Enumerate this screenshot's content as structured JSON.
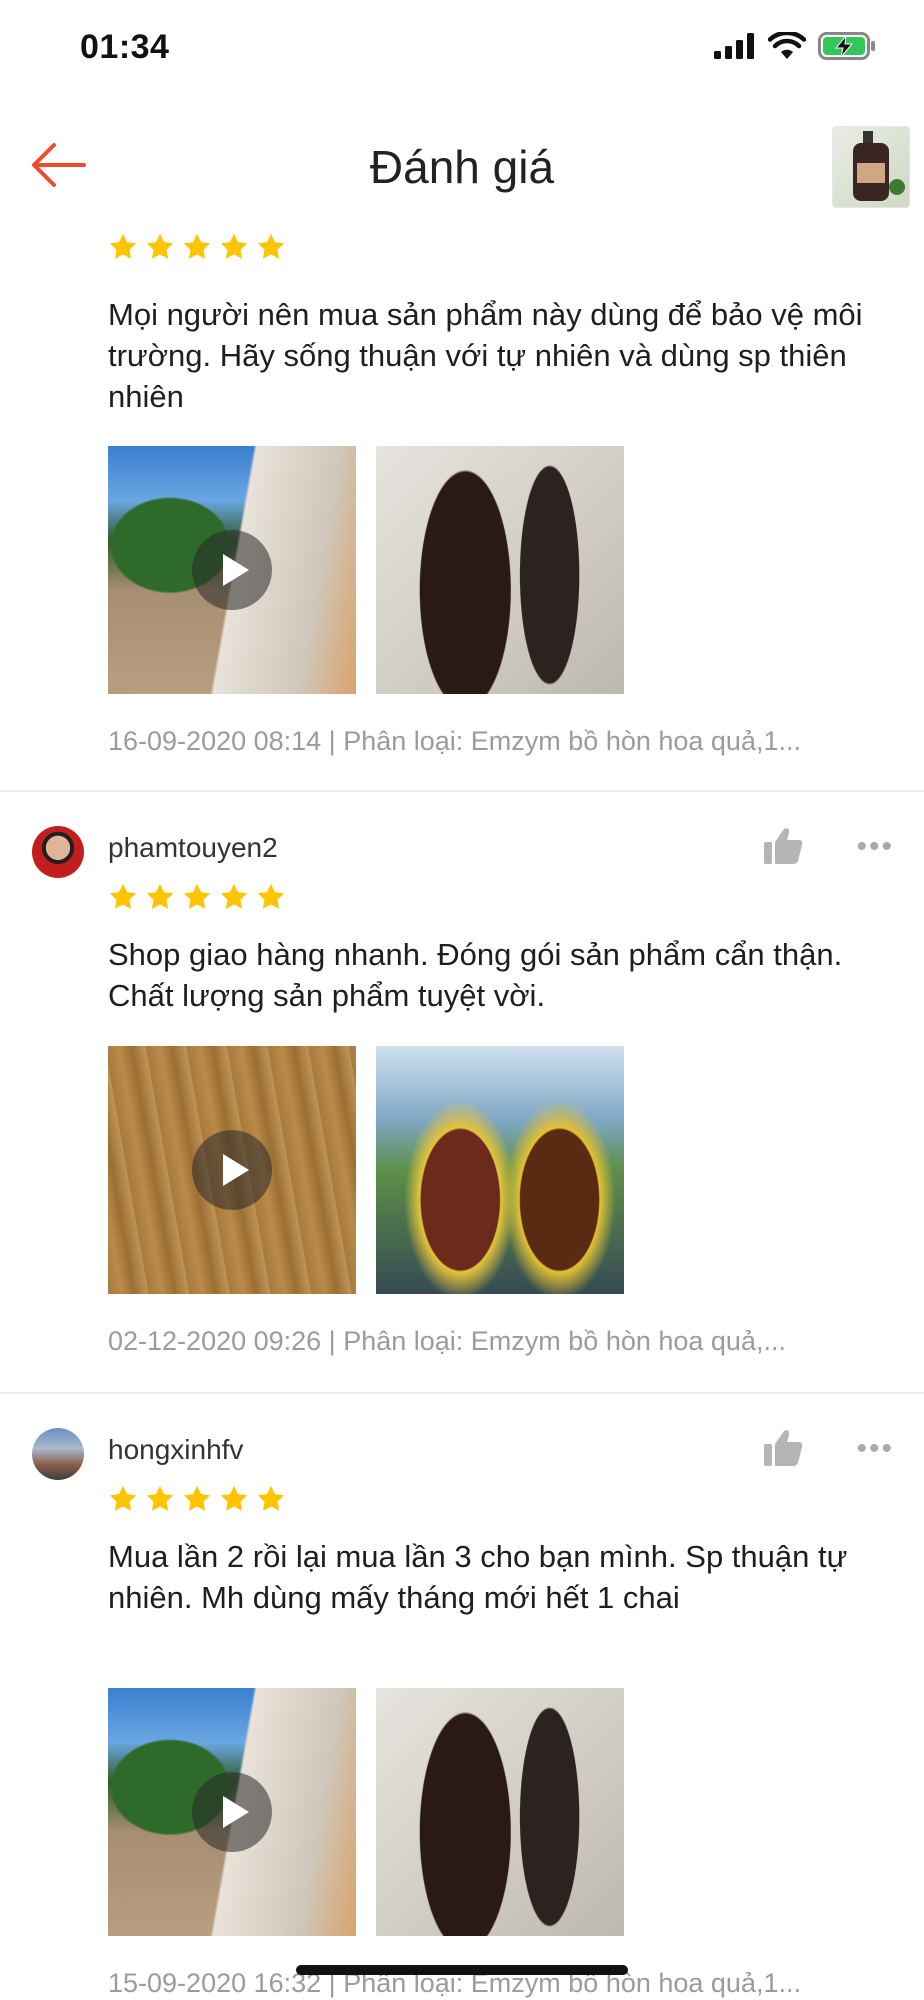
{
  "status_bar": {
    "time": "01:34"
  },
  "header": {
    "title": "Đánh giá"
  },
  "reviews": [
    {
      "username": "",
      "rating": 5,
      "text": "Mọi người nên mua sản phẩm này dùng để bảo vệ môi trường. Hãy sống thuận với tự nhiên và dùng sp thiên nhiên",
      "meta": "16-09-2020 08:14 | Phân loại: Emzym bồ hòn hoa quả,1..."
    },
    {
      "username": "phamtouyen2",
      "rating": 5,
      "text": "Shop giao hàng nhanh. Đóng gói sản phẩm cẩn thận. Chất lượng sản phẩm tuyệt vời.",
      "meta": "02-12-2020 09:26 | Phân loại: Emzym bồ hòn hoa quả,..."
    },
    {
      "username": "hongxinhfv",
      "rating": 5,
      "text": "Mua lần 2 rồi lại mua lần 3 cho bạn mình. Sp thuận tự nhiên. Mh dùng mấy tháng mới hết 1 chai",
      "meta": "15-09-2020 16:32 | Phân loại: Emzym bồ hòn hoa quả,1..."
    }
  ],
  "colors": {
    "accent": "#ee4d2d",
    "star": "#ffc400",
    "meta_text": "#9b9b9b"
  }
}
